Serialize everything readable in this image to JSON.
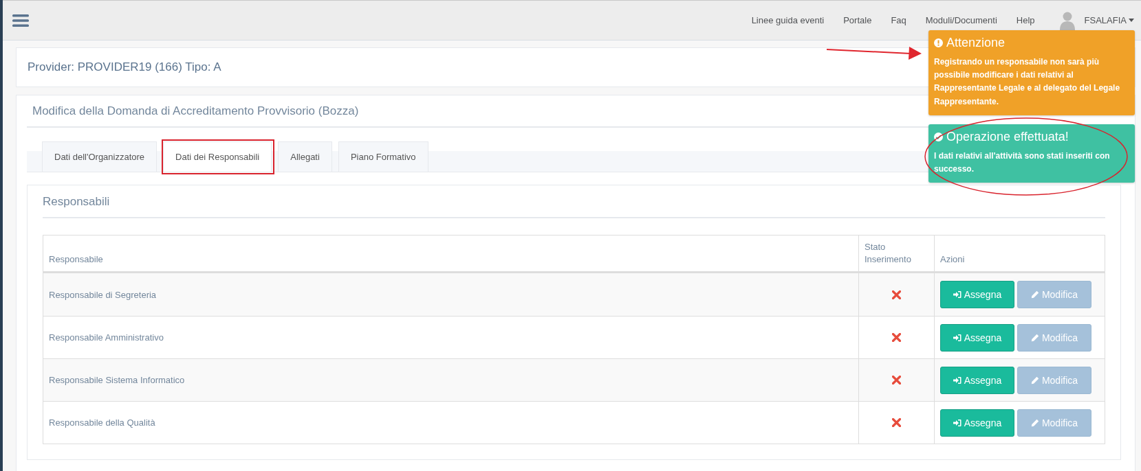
{
  "header": {
    "nav": [
      "Linee guida eventi",
      "Portale",
      "Faq",
      "Moduli/Documenti",
      "Help"
    ],
    "user": {
      "name": "FSALAFIA"
    }
  },
  "provider_panel": {
    "title": "Provider: PROVIDER19 (166) Tipo: A"
  },
  "form": {
    "title": "Modifica della Domanda di Accreditamento Provvisorio (Bozza)",
    "tabs": [
      {
        "label": "Dati dell'Organizzatore",
        "selected": false
      },
      {
        "label": "Dati dei Responsabili",
        "selected": true
      },
      {
        "label": "Allegati",
        "selected": false
      },
      {
        "label": "Piano Formativo",
        "selected": false
      }
    ],
    "section": {
      "title": "Responsabili",
      "table": {
        "columns": [
          "Responsabile",
          "Stato Inserimento",
          "Azioni"
        ],
        "rows": [
          {
            "responsabile": "Responsabile di Segreteria",
            "inserted": false,
            "actions": [
              {
                "label": "Assegna",
                "kind": "assign",
                "disabled": false
              },
              {
                "label": "Modifica",
                "kind": "edit",
                "disabled": true
              }
            ]
          },
          {
            "responsabile": "Responsabile Amministrativo",
            "inserted": false,
            "actions": [
              {
                "label": "Assegna",
                "kind": "assign",
                "disabled": false
              },
              {
                "label": "Modifica",
                "kind": "edit",
                "disabled": true
              }
            ]
          },
          {
            "responsabile": "Responsabile Sistema Informatico",
            "inserted": false,
            "actions": [
              {
                "label": "Assegna",
                "kind": "assign",
                "disabled": false
              },
              {
                "label": "Modifica",
                "kind": "edit",
                "disabled": true
              }
            ]
          },
          {
            "responsabile": "Responsabile della Qualità",
            "inserted": false,
            "actions": [
              {
                "label": "Assegna",
                "kind": "assign",
                "disabled": false
              },
              {
                "label": "Modifica",
                "kind": "edit",
                "disabled": true
              }
            ]
          }
        ]
      }
    }
  },
  "notifications": [
    {
      "kind": "warning",
      "title": "Attenzione",
      "message": "Registrando un responsabile non sarà più possibile modificare i dati relativi al Rappresentante Legale e al delegato del Legale Rappresentante."
    },
    {
      "kind": "success",
      "title": "Operazione effettuata!",
      "message": "I dati relativi all'attività sono stati inseriti con successo."
    }
  ]
}
